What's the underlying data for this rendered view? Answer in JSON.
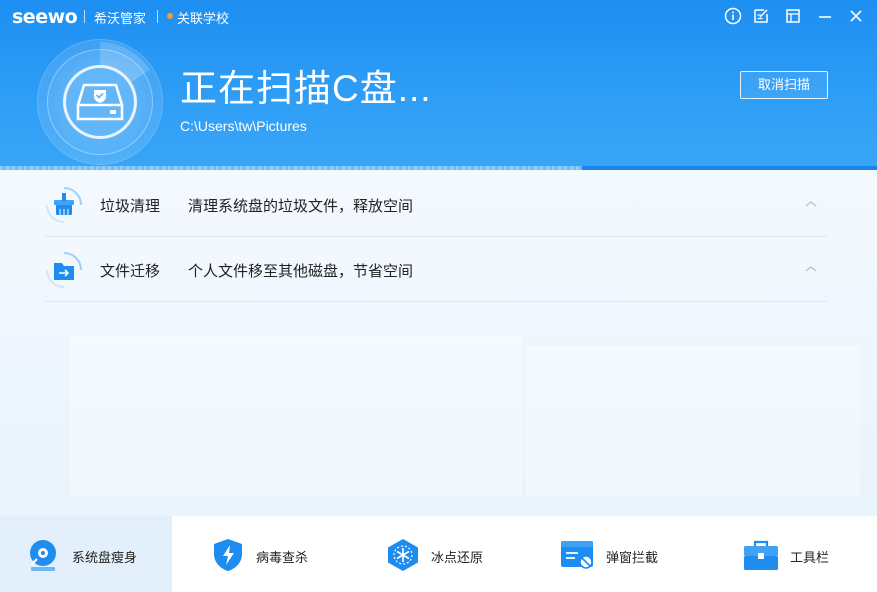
{
  "titlebar": {
    "brand": "seewo",
    "app_name": "希沃管家",
    "school": "关联学校",
    "icons": [
      "info-icon",
      "feedback-icon",
      "skin-icon",
      "minimize-icon",
      "close-icon"
    ]
  },
  "scan": {
    "title": "正在扫描C盘...",
    "path": "C:\\Users\\tw\\Pictures",
    "cancel_label": "取消扫描",
    "progress": 0.664
  },
  "items": [
    {
      "name": "垃圾清理",
      "desc": "清理系统盘的垃圾文件，释放空间",
      "icon": "broom-icon"
    },
    {
      "name": "文件迁移",
      "desc": "个人文件移至其他磁盘，节省空间",
      "icon": "folder-move-icon"
    }
  ],
  "nav": [
    {
      "label": "系统盘瘦身",
      "icon": "disk-slim-icon",
      "active": true
    },
    {
      "label": "病毒查杀",
      "icon": "shield-bolt-icon",
      "active": false
    },
    {
      "label": "冰点还原",
      "icon": "snowflake-icon",
      "active": false
    },
    {
      "label": "弹窗拦截",
      "icon": "popup-block-icon",
      "active": false
    },
    {
      "label": "工具栏",
      "icon": "toolbox-icon",
      "active": false
    }
  ],
  "colors": {
    "primary": "#1d8ff2",
    "accent_orange": "#ff9b2e",
    "active_nav_bg": "#e3effb"
  }
}
